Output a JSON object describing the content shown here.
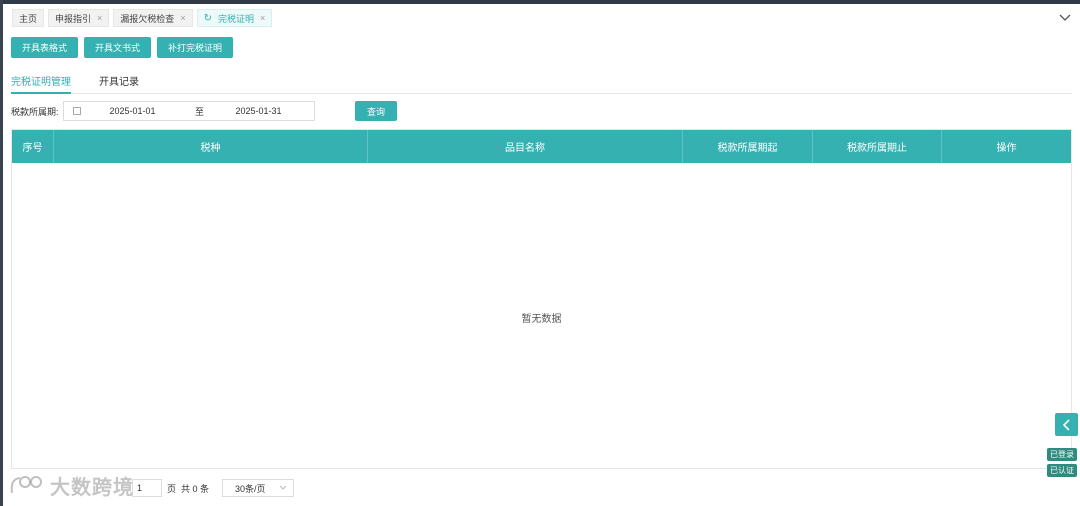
{
  "tabs": [
    {
      "label": "主页",
      "closable": false,
      "active": false
    },
    {
      "label": "申报指引",
      "closable": true,
      "active": false
    },
    {
      "label": "漏报欠税检查",
      "closable": true,
      "active": false
    },
    {
      "label": "完税证明",
      "closable": true,
      "active": true
    }
  ],
  "tab_close_glyph": "×",
  "toolbar": {
    "btn1": "开具表格式",
    "btn2": "开具文书式",
    "btn3": "补打完税证明"
  },
  "subtabs": {
    "manage": "完税证明管理",
    "records": "开具记录"
  },
  "filter": {
    "label": "税款所属期:",
    "start": "2025-01-01",
    "sep": "至",
    "end": "2025-01-31",
    "query": "查询"
  },
  "grid": {
    "columns": [
      "序号",
      "税种",
      "品目名称",
      "税款所属期起",
      "税款所属期止",
      "操作"
    ],
    "empty_text": "暂无数据"
  },
  "pager": {
    "page": "1",
    "page_unit": "页",
    "total": "共 0 条",
    "page_size": "30条/页"
  },
  "watermark": "大数跨境",
  "badges": {
    "logged_in": "已登录",
    "verified": "已认证"
  },
  "colors": {
    "accent": "#36b1b1",
    "badge": "#2f8a7f"
  }
}
